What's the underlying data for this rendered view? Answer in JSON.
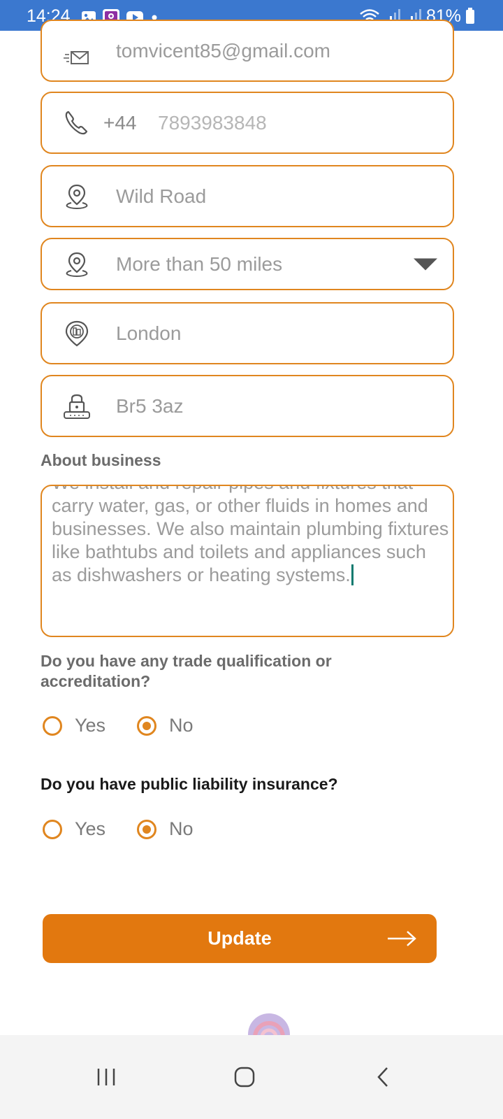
{
  "status_bar": {
    "time": "14:24",
    "battery": "81%",
    "icons": [
      "gallery-icon",
      "app-icon",
      "youtube-icon",
      "dot-icon",
      "wifi-icon",
      "signal-icon",
      "signal-icon",
      "battery-icon"
    ]
  },
  "form": {
    "email": {
      "value": "tomvicent85@gmail.com",
      "icon": "email-icon"
    },
    "phone": {
      "country_code": "+44",
      "value": "7893983848",
      "icon": "phone-icon"
    },
    "address": {
      "value": "Wild Road",
      "icon": "location-pin-icon"
    },
    "distance": {
      "value": "More than 50 miles",
      "icon": "location-pin-icon"
    },
    "city": {
      "value": "London",
      "icon": "city-pin-icon"
    },
    "postcode": {
      "value": "Br5 3az",
      "icon": "postcode-icon"
    },
    "about": {
      "label": "About business",
      "value": "We install and repair pipes and fixtures that carry water, gas, or other fluids in homes and businesses. We also maintain plumbing fixtures like bathtubs and toilets and appliances such as dishwashers or heating systems."
    },
    "qualification": {
      "question": "Do you have any trade qualification or accreditation?",
      "options": [
        "Yes",
        "No"
      ],
      "selected": "No"
    },
    "insurance": {
      "question": "Do you have public liability insurance?",
      "options": [
        "Yes",
        "No"
      ],
      "selected": "No"
    }
  },
  "update_button": {
    "label": "Update"
  },
  "colors": {
    "accent": "#e0861f",
    "button": "#e2780f",
    "status_bar": "#3b78cf"
  }
}
